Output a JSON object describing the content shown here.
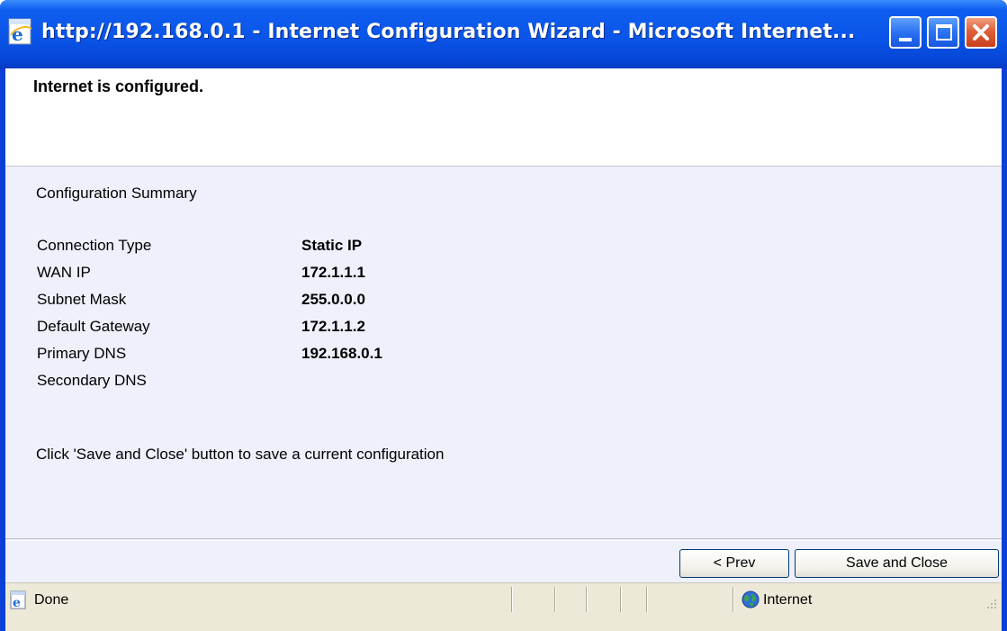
{
  "window": {
    "title": "http://192.168.0.1 - Internet Configuration Wizard - Microsoft Internet...",
    "controls": {
      "minimize": "minimize-icon",
      "maximize": "maximize-icon",
      "close": "close-icon"
    }
  },
  "header": {
    "message": "Internet is configured."
  },
  "summary": {
    "title": "Configuration Summary",
    "rows": [
      {
        "label": "Connection Type",
        "value": "Static IP"
      },
      {
        "label": "WAN IP",
        "value": "172.1.1.1"
      },
      {
        "label": "Subnet Mask",
        "value": "255.0.0.0"
      },
      {
        "label": "Default Gateway",
        "value": "172.1.1.2"
      },
      {
        "label": "Primary DNS",
        "value": "192.168.0.1"
      },
      {
        "label": "Secondary DNS",
        "value": ""
      }
    ],
    "note": "Click 'Save and Close' button to save a current configuration"
  },
  "buttons": {
    "prev": "< Prev",
    "save": "Save and Close"
  },
  "statusbar": {
    "status": "Done",
    "zone": "Internet"
  },
  "colors": {
    "titlebar": "#0a55e8",
    "content_bg": "#eef0fb",
    "statusbar_bg": "#ece9d8",
    "close_button": "#e0603a"
  }
}
